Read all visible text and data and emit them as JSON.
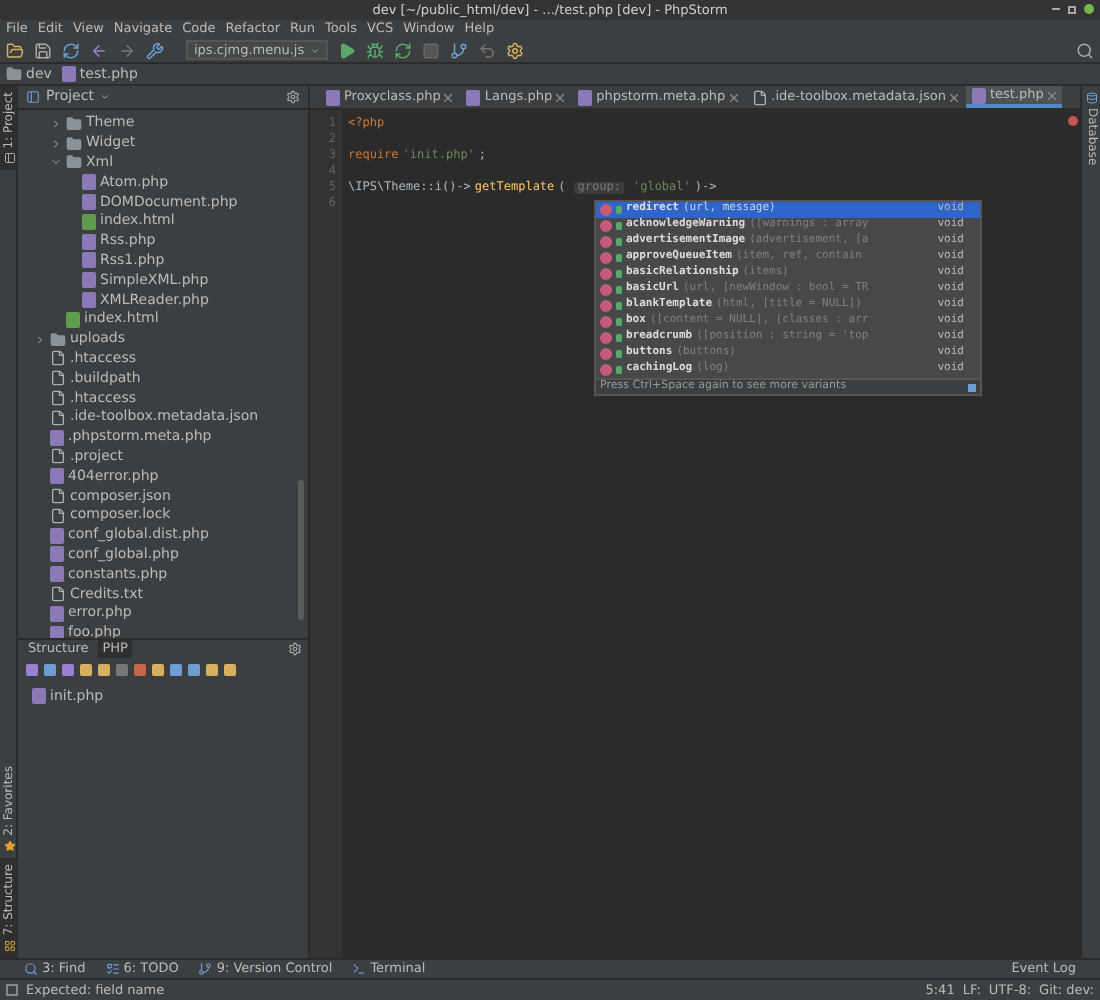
{
  "window": {
    "title": "dev [~/public_html/dev] - .../test.php [dev] - PhpStorm"
  },
  "menu": [
    "File",
    "Edit",
    "View",
    "Navigate",
    "Code",
    "Refactor",
    "Run",
    "Tools",
    "VCS",
    "Window",
    "Help"
  ],
  "toolbar": {
    "run_config": "ips.cjmg.menu.js"
  },
  "breadcrumbs": [
    {
      "label": "dev",
      "kind": "folder"
    },
    {
      "label": "test.php",
      "kind": "php"
    }
  ],
  "left_tool_tabs": [
    {
      "label": "1: Project",
      "selected": true,
      "kind": "project"
    },
    {
      "label": "2: Favorites",
      "selected": false,
      "kind": "favorites"
    },
    {
      "label": "7: Structure",
      "selected": true,
      "kind": "structure"
    }
  ],
  "project_panel": {
    "title": "Project",
    "tree": [
      {
        "children": [
          {
            "label": "Theme",
            "kind": "folder",
            "expanded": false
          },
          {
            "label": "Widget",
            "kind": "folder",
            "expanded": false
          },
          {
            "label": "Xml",
            "kind": "folder",
            "expanded": true,
            "children": [
              {
                "label": "Atom.php",
                "kind": "php"
              },
              {
                "label": "DOMDocument.php",
                "kind": "php"
              },
              {
                "label": "index.html",
                "kind": "html"
              },
              {
                "label": "Rss.php",
                "kind": "php"
              },
              {
                "label": "Rss1.php",
                "kind": "php"
              },
              {
                "label": "SimpleXML.php",
                "kind": "php"
              },
              {
                "label": "XMLReader.php",
                "kind": "php"
              }
            ]
          },
          {
            "label": "index.html",
            "kind": "html"
          }
        ]
      },
      {
        "label": "uploads",
        "kind": "folder",
        "expanded": false
      },
      {
        "label": ".htaccess",
        "kind": "file"
      },
      {
        "label": ".buildpath",
        "kind": "file"
      },
      {
        "label": ".htaccess",
        "kind": "file"
      },
      {
        "label": ".ide-toolbox.metadata.json",
        "kind": "file"
      },
      {
        "label": ".phpstorm.meta.php",
        "kind": "php"
      },
      {
        "label": ".project",
        "kind": "file"
      },
      {
        "label": "404error.php",
        "kind": "php"
      },
      {
        "label": "composer.json",
        "kind": "file"
      },
      {
        "label": "composer.lock",
        "kind": "file"
      },
      {
        "label": "conf_global.dist.php",
        "kind": "php"
      },
      {
        "label": "conf_global.php",
        "kind": "php"
      },
      {
        "label": "constants.php",
        "kind": "php"
      },
      {
        "label": "Credits.txt",
        "kind": "file"
      },
      {
        "label": "error.php",
        "kind": "php"
      },
      {
        "label": "foo.php",
        "kind": "php"
      }
    ]
  },
  "structure_panel": {
    "tabs": [
      {
        "label": "Structure",
        "selected": false
      },
      {
        "label": "PHP",
        "selected": true
      }
    ],
    "items": [
      "init.php"
    ]
  },
  "editor": {
    "tabs": [
      {
        "label": "Proxyclass.php",
        "selected": false,
        "kind": "php"
      },
      {
        "label": "Langs.php",
        "selected": false,
        "kind": "php"
      },
      {
        "label": "phpstorm.meta.php",
        "selected": false,
        "kind": "php"
      },
      {
        "label": ".ide-toolbox.metadata.json",
        "selected": false,
        "kind": "file"
      },
      {
        "label": "test.php",
        "selected": true,
        "kind": "php"
      }
    ],
    "lines": [
      {
        "number": "1",
        "tokens": [
          {
            "kind": "keyword",
            "text": "<?php"
          }
        ]
      },
      {
        "number": "2"
      },
      {
        "number": "3",
        "tokens": [
          {
            "kind": "keyword",
            "text": "require"
          },
          {
            "kind": "string",
            "text": "'init.php'"
          },
          {
            "kind": "plain",
            "text": ";"
          }
        ]
      },
      {
        "number": "4"
      },
      {
        "number": "5",
        "tokens": [
          {
            "kind": "plain",
            "text": "\\IPS\\Theme::i()->"
          },
          {
            "kind": "method",
            "text": "getTemplate"
          },
          {
            "kind": "plain",
            "text": "("
          },
          {
            "kind": "hint",
            "text": "group:"
          },
          {
            "kind": "string",
            "text": "'global'"
          },
          {
            "kind": "plain",
            "text": ")->"
          }
        ]
      },
      {
        "number": "6"
      }
    ]
  },
  "completion": {
    "items": [
      {
        "name": "redirect",
        "params": "(url, message)",
        "type": "void",
        "selected": true
      },
      {
        "name": "acknowledgeWarning",
        "params": "([warnings : array",
        "type": "void",
        "selected": false
      },
      {
        "name": "advertisementImage",
        "params": "(advertisement, [a",
        "type": "void",
        "selected": false
      },
      {
        "name": "approveQueueItem",
        "params": "(item, ref, contain",
        "type": "void",
        "selected": false
      },
      {
        "name": "basicRelationship",
        "params": "(items)",
        "type": "void",
        "selected": false
      },
      {
        "name": "basicUrl",
        "params": "(url, [newWindow : bool = TR",
        "type": "void",
        "selected": false
      },
      {
        "name": "blankTemplate",
        "params": "(html, [title = NULL])",
        "type": "void",
        "selected": false
      },
      {
        "name": "box",
        "params": "([content = NULL], [classes : arr",
        "type": "void",
        "selected": false
      },
      {
        "name": "breadcrumb",
        "params": "([position : string = 'top",
        "type": "void",
        "selected": false
      },
      {
        "name": "buttons",
        "params": "(buttons)",
        "type": "void",
        "selected": false
      },
      {
        "name": "cachingLog",
        "params": "(log)",
        "type": "void",
        "selected": false
      }
    ],
    "hint": "Press Ctrl+Space again to see more variants"
  },
  "right_tool_tabs": [
    "Database"
  ],
  "bottom_tool_tabs": [
    {
      "label": "3: Find",
      "kind": "find"
    },
    {
      "label": "6: TODO",
      "kind": "todo"
    },
    {
      "label": "9: Version Control",
      "kind": "vcs"
    },
    {
      "label": "Terminal",
      "kind": "terminal"
    }
  ],
  "event_log": "Event Log",
  "status_bar": {
    "message": "Expected: field name",
    "items": [
      "5:41",
      "LF:",
      "UTF-8:",
      "Git: dev:"
    ]
  }
}
